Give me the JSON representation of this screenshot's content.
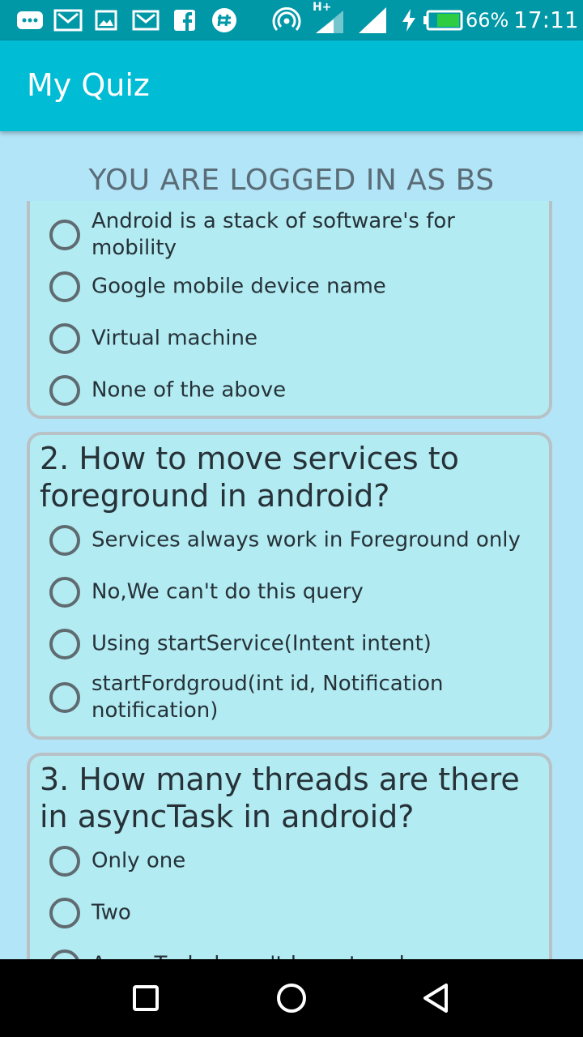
{
  "status_bar": {
    "battery_percent": "66%",
    "time": "17:11",
    "network_label": "H+",
    "icons": [
      "more-notifications-icon",
      "gmail-icon",
      "image-icon",
      "gmail-icon",
      "facebook-icon",
      "slack-icon",
      "hotspot-icon",
      "signal-icon",
      "signal-icon",
      "charging-icon",
      "battery-icon"
    ]
  },
  "app_bar": {
    "title": "My Quiz"
  },
  "header": {
    "logged_in_text": "YOU ARE LOGGED IN AS BS"
  },
  "questions": [
    {
      "title": "",
      "options": [
        "Android is a stack of software's for mobility",
        "Google mobile device name",
        "Virtual machine",
        "None of the above"
      ]
    },
    {
      "title": "2. How to move services to foreground in android?",
      "options": [
        "Services always work in Foreground only",
        "No,We can't do this query",
        "Using startService(Intent intent)",
        "startFordgroud(int id, Notification notification)"
      ]
    },
    {
      "title": "3. How many threads are there in asyncTask in android?",
      "options": [
        "Only one",
        "Two",
        "AsyncTask doesn't have tread"
      ]
    }
  ],
  "colors": {
    "status_bar": "#0097a7",
    "app_bar": "#00bcd4",
    "background": "#b3e5f8",
    "card": "#b2ebf2",
    "card_border": "#b8c2c6",
    "nav_bar": "#000000"
  },
  "nav_bar": {
    "icons": [
      "recents-icon",
      "home-icon",
      "back-icon"
    ]
  }
}
